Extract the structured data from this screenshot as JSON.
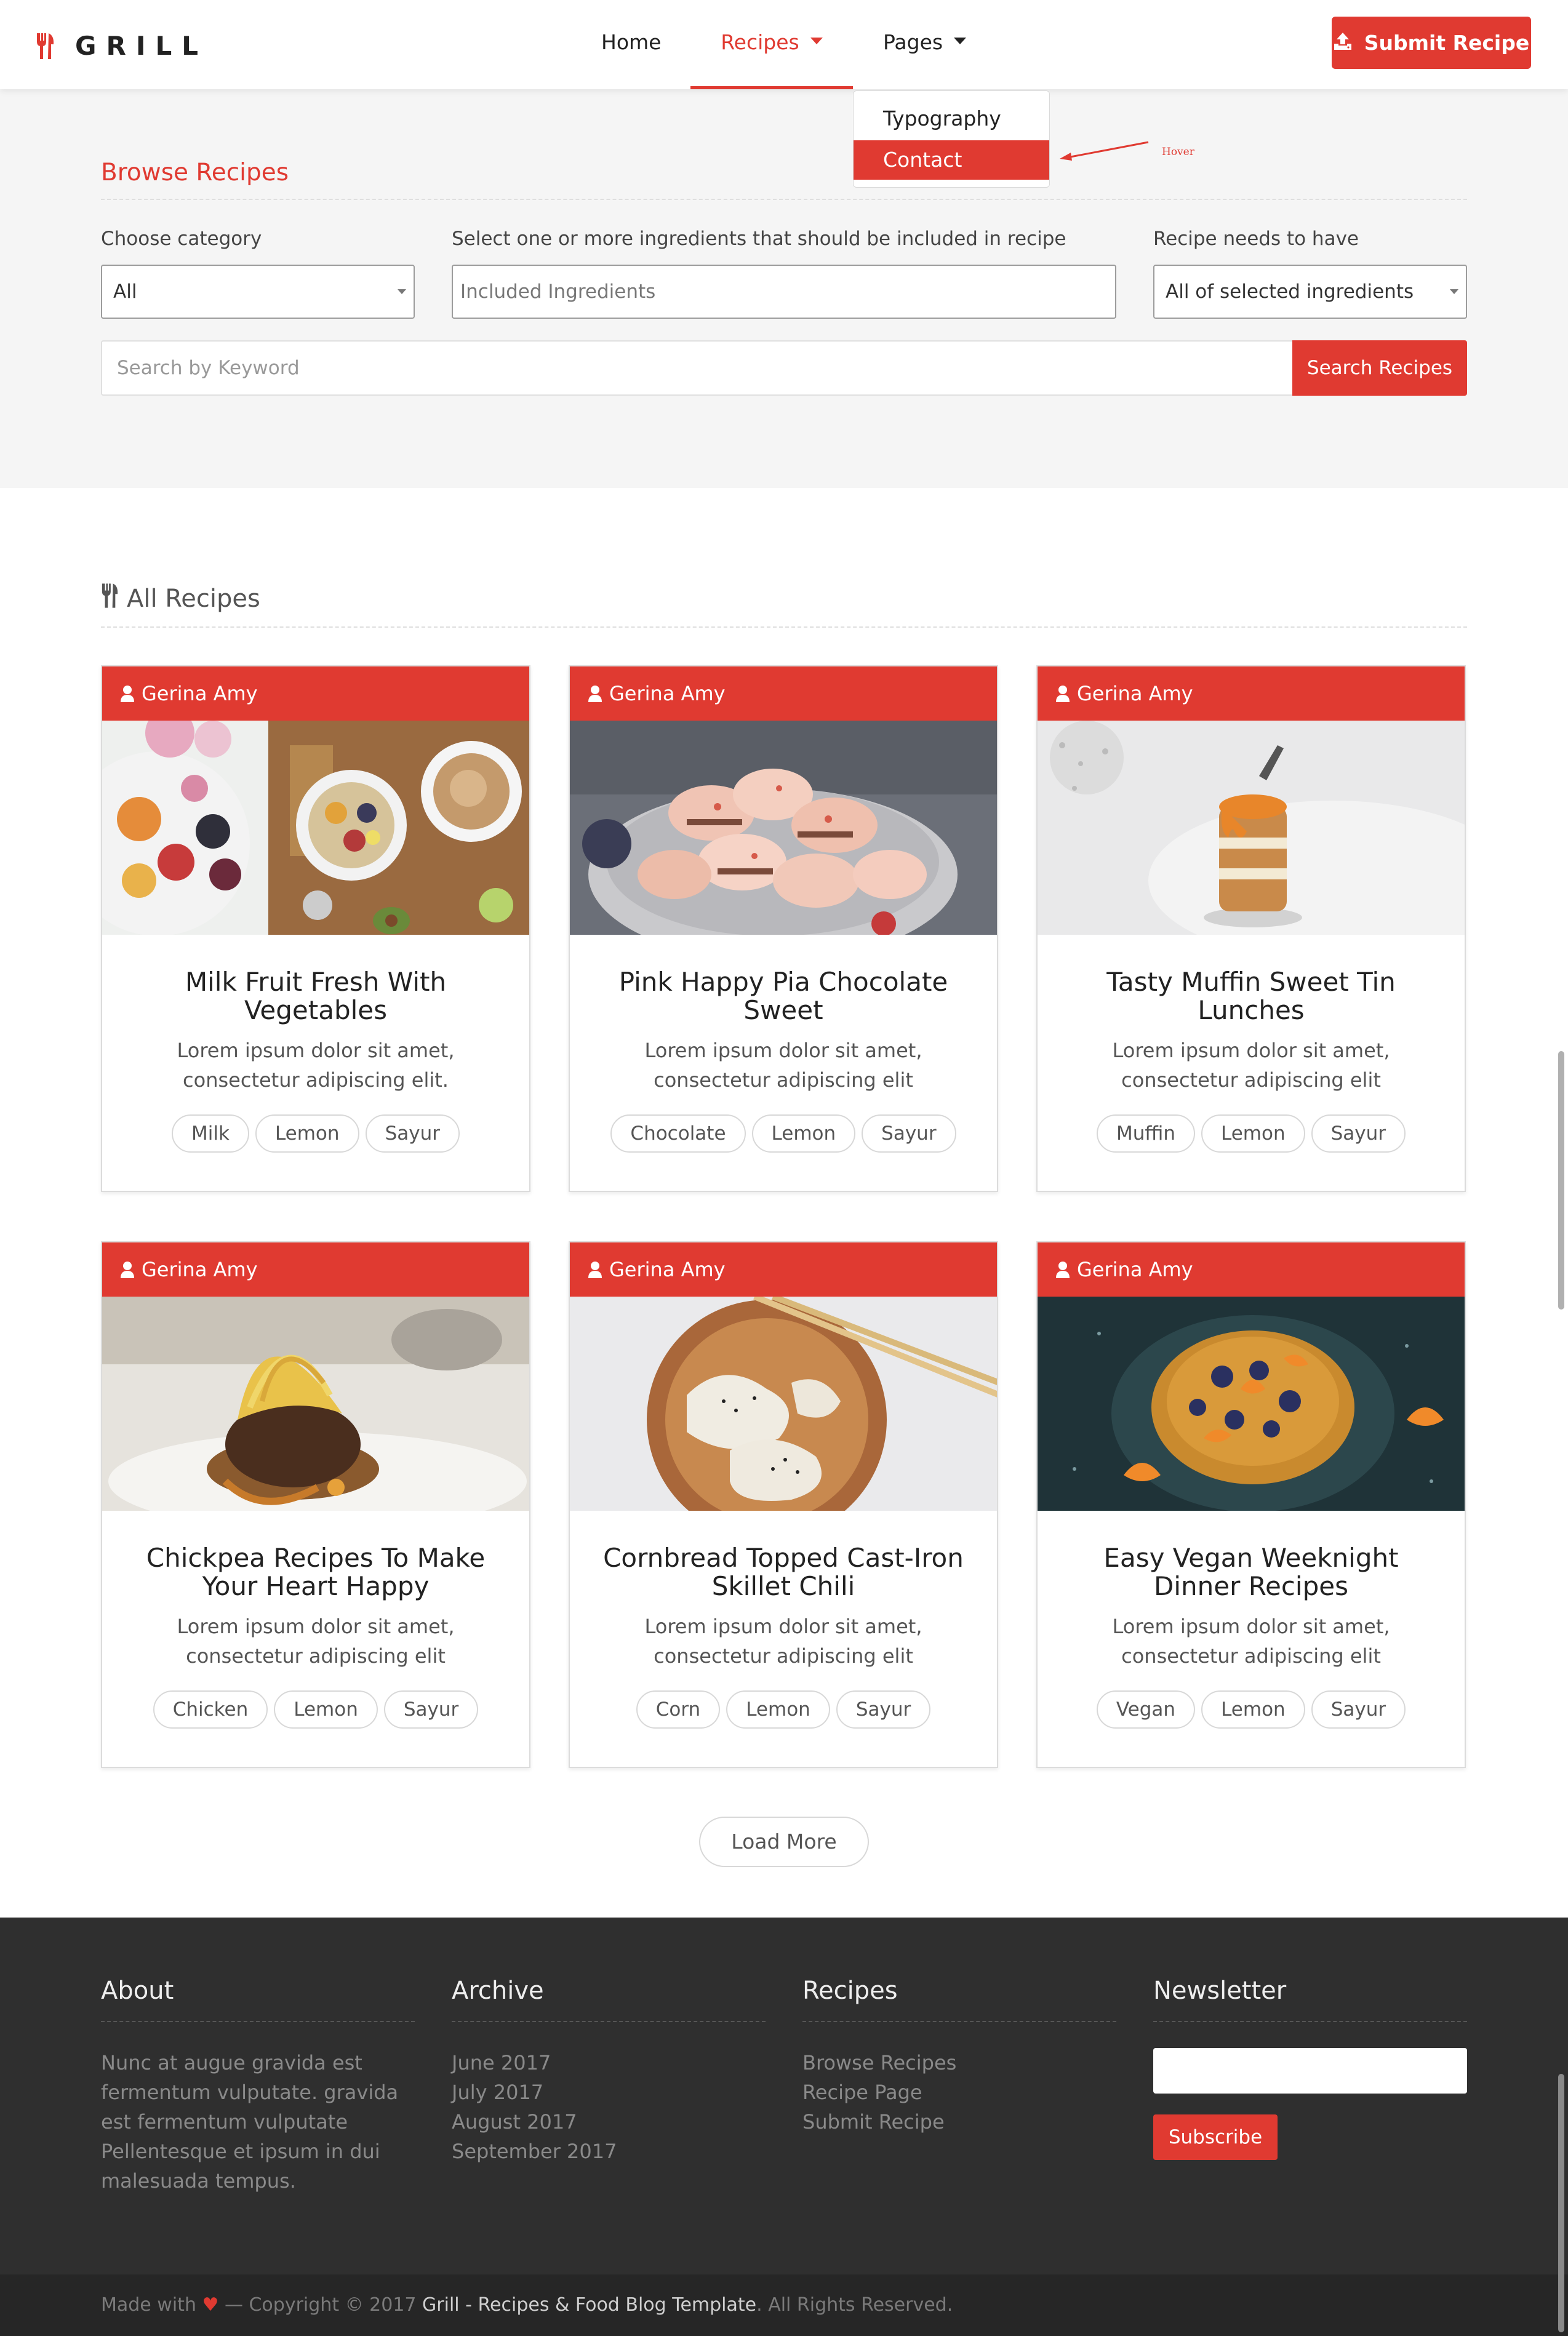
{
  "header": {
    "logo_text": "GRILL",
    "nav": {
      "home": "Home",
      "recipes": "Recipes",
      "pages": "Pages"
    },
    "submit_label": "Submit Recipe"
  },
  "dropdown": {
    "items": [
      "Typography",
      "Contact"
    ],
    "annotation": "Hover"
  },
  "browse": {
    "title": "Browse Recipes",
    "category_label": "Choose category",
    "category_value": "All",
    "ingredients_label": "Select one or more ingredients that should be included in recipe",
    "ingredients_placeholder": "Included Ingredients",
    "needs_label": "Recipe needs to have",
    "needs_value": "All of selected ingredients",
    "search_placeholder": "Search by Keyword",
    "search_button": "Search Recipes"
  },
  "all_recipes": {
    "title": "All Recipes",
    "load_more": "Load More",
    "cards": [
      {
        "author": "Gerina Amy",
        "title": "Milk Fruit Fresh With Vegetables",
        "desc": "Lorem ipsum dolor sit amet, consectetur adipiscing elit.",
        "tags": [
          "Milk",
          "Lemon",
          "Sayur"
        ]
      },
      {
        "author": "Gerina Amy",
        "title": "Pink Happy Pia Chocolate Sweet",
        "desc": "Lorem ipsum dolor sit amet, consectetur adipiscing elit",
        "tags": [
          "Chocolate",
          "Lemon",
          "Sayur"
        ]
      },
      {
        "author": "Gerina Amy",
        "title": "Tasty Muffin Sweet Tin Lunches",
        "desc": "Lorem ipsum dolor sit amet, consectetur adipiscing elit",
        "tags": [
          "Muffin",
          "Lemon",
          "Sayur"
        ]
      },
      {
        "author": "Gerina Amy",
        "title": "Chickpea Recipes To Make Your Heart Happy",
        "desc": "Lorem ipsum dolor sit amet, consectetur adipiscing elit",
        "tags": [
          "Chicken",
          "Lemon",
          "Sayur"
        ]
      },
      {
        "author": "Gerina Amy",
        "title": "Cornbread Topped Cast-Iron Skillet Chili",
        "desc": "Lorem ipsum dolor sit amet, consectetur adipiscing elit",
        "tags": [
          "Corn",
          "Lemon",
          "Sayur"
        ]
      },
      {
        "author": "Gerina Amy",
        "title": "Easy Vegan Weeknight Dinner Recipes",
        "desc": "Lorem ipsum dolor sit amet, consectetur adipiscing elit",
        "tags": [
          "Vegan",
          "Lemon",
          "Sayur"
        ]
      }
    ]
  },
  "footer": {
    "about_title": "About",
    "about_text": "Nunc at augue gravida est fermentum vulputate. gravida est fermentum vulputate Pellentesque et ipsum in dui malesuada tempus.",
    "archive_title": "Archive",
    "archive_links": [
      "June 2017",
      "July 2017",
      "August 2017",
      "September 2017"
    ],
    "recipes_title": "Recipes",
    "recipes_links": [
      "Browse Recipes",
      "Recipe Page",
      "Submit Recipe"
    ],
    "newsletter_title": "Newsletter",
    "subscribe_label": "Subscribe"
  },
  "copyright": {
    "made_with": "Made with",
    "mid": "— Copyright © 2017",
    "brand": "Grill - Recipes & Food Blog Template",
    "rights": ". All Rights Reserved."
  },
  "colors": {
    "accent": "#e03a31",
    "footer_bg": "#2f2f2f",
    "browse_bg": "#f5f5f5"
  }
}
